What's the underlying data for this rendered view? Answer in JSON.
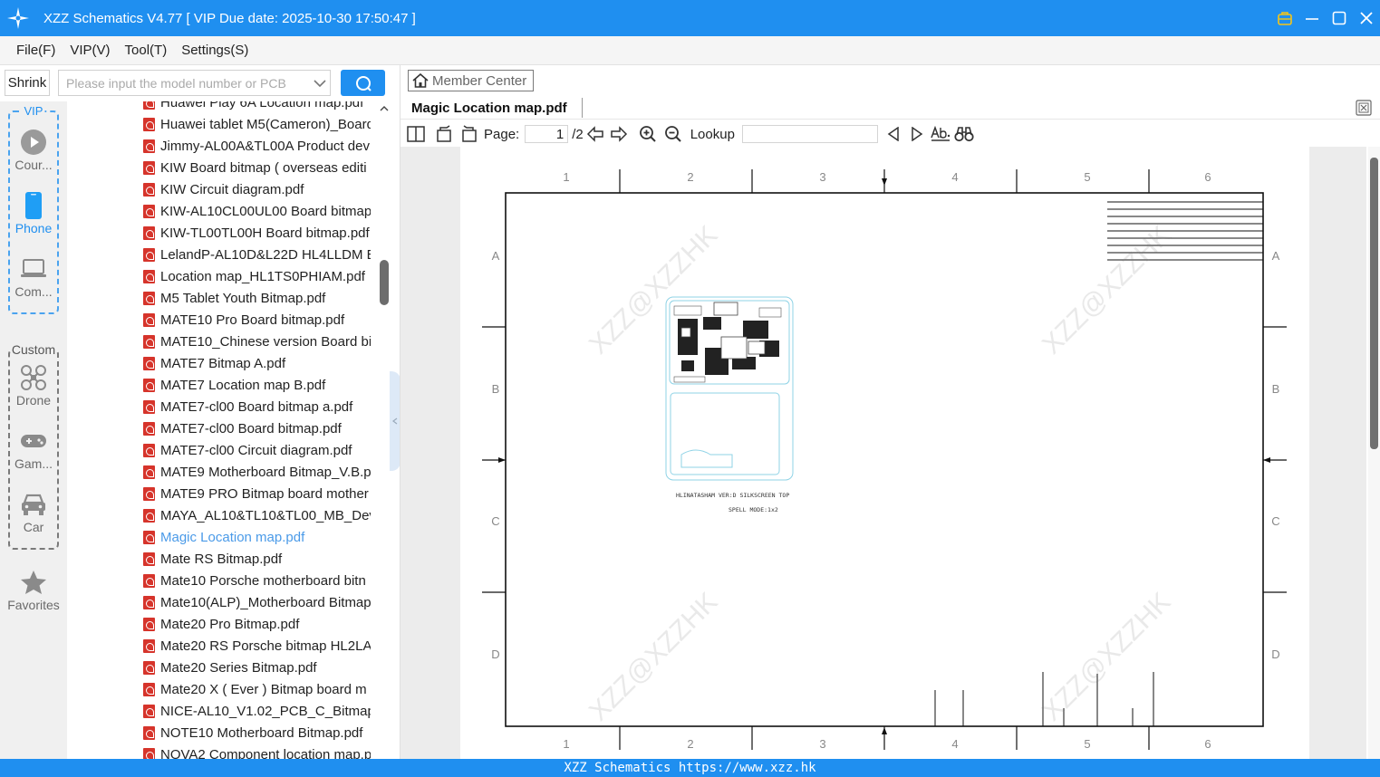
{
  "window": {
    "title": "XZZ Schematics V4.77 [ VIP Due date: 2025-10-30 17:50:47 ]"
  },
  "menu": {
    "items": [
      "File(F)",
      "VIP(V)",
      "Tool(T)",
      "Settings(S)"
    ]
  },
  "search": {
    "shrink_label": "Shrink",
    "placeholder": "Please input the model number or PCB"
  },
  "categories": {
    "vip_label": "VIP",
    "custom_label": "Custom",
    "items": [
      {
        "label": "Cour...",
        "icon": "play-icon"
      },
      {
        "label": "Phone",
        "icon": "phone-icon",
        "active": true
      },
      {
        "label": "Com...",
        "icon": "laptop-icon"
      },
      {
        "label": "Drone",
        "icon": "drone-icon"
      },
      {
        "label": "Gam...",
        "icon": "gamepad-icon"
      },
      {
        "label": "Car",
        "icon": "car-icon"
      },
      {
        "label": "Favorites",
        "icon": "star-icon"
      }
    ]
  },
  "files": [
    "Huawei Play 6A Location map.pdf",
    "Huawei tablet M5(Cameron)_Board",
    "Jimmy-AL00A&TL00A Product dev",
    "KIW Board bitmap ( overseas editi",
    "KIW Circuit diagram.pdf",
    "KIW-AL10CL00UL00 Board bitmap.",
    "KIW-TL00TL00H Board bitmap.pdf",
    "LelandP-AL10D&L22D HL4LLDM B",
    "Location map_HL1TS0PHIAM.pdf",
    "M5 Tablet Youth Bitmap.pdf",
    "MATE10 Pro Board bitmap.pdf",
    "MATE10_Chinese version Board bit",
    "MATE7 Bitmap A.pdf",
    "MATE7 Location map B.pdf",
    "MATE7-cl00 Board bitmap a.pdf",
    "MATE7-cl00 Board bitmap.pdf",
    "MATE7-cl00 Circuit diagram.pdf",
    "MATE9 Motherboard Bitmap_V.B.p",
    "MATE9 PRO Bitmap board mother",
    "MAYA_AL10&TL10&TL00_MB_Devi",
    "Magic Location map.pdf",
    "Mate RS Bitmap.pdf",
    "Mate10 Porsche motherboard bitn",
    "Mate10(ALP)_Motherboard Bitmap",
    "Mate20 Pro Bitmap.pdf",
    "Mate20 RS Porsche bitmap HL2LA'",
    "Mate20 Series Bitmap.pdf",
    "Mate20 X ( Ever ) Bitmap board m",
    "NICE-AL10_V1.02_PCB_C_Bitmap(1",
    "NOTE10 Motherboard Bitmap.pdf",
    "NOVA2 Component location map.p"
  ],
  "selected_index": 20,
  "viewer": {
    "member_center": "Member Center",
    "tab_title": "Magic Location map.pdf",
    "page_label": "Page:",
    "page_current": "1",
    "page_total": "/2",
    "lookup_label": "Lookup"
  },
  "schematic": {
    "col_labels": [
      "1",
      "2",
      "3",
      "4",
      "5",
      "6"
    ],
    "row_labels": [
      "A",
      "B",
      "C",
      "D"
    ],
    "caption_line1": "HLINATASHAM VER:D SILKSCREEN TOP",
    "caption_line2": "SPELL MODE:1x2",
    "watermark": "XZZ@XZZHK"
  },
  "status": {
    "text": "XZZ Schematics https://www.xzz.hk"
  },
  "colors": {
    "accent": "#1f8ff0",
    "pdf_red": "#d6342b",
    "selected_text": "#4a9ae8"
  }
}
